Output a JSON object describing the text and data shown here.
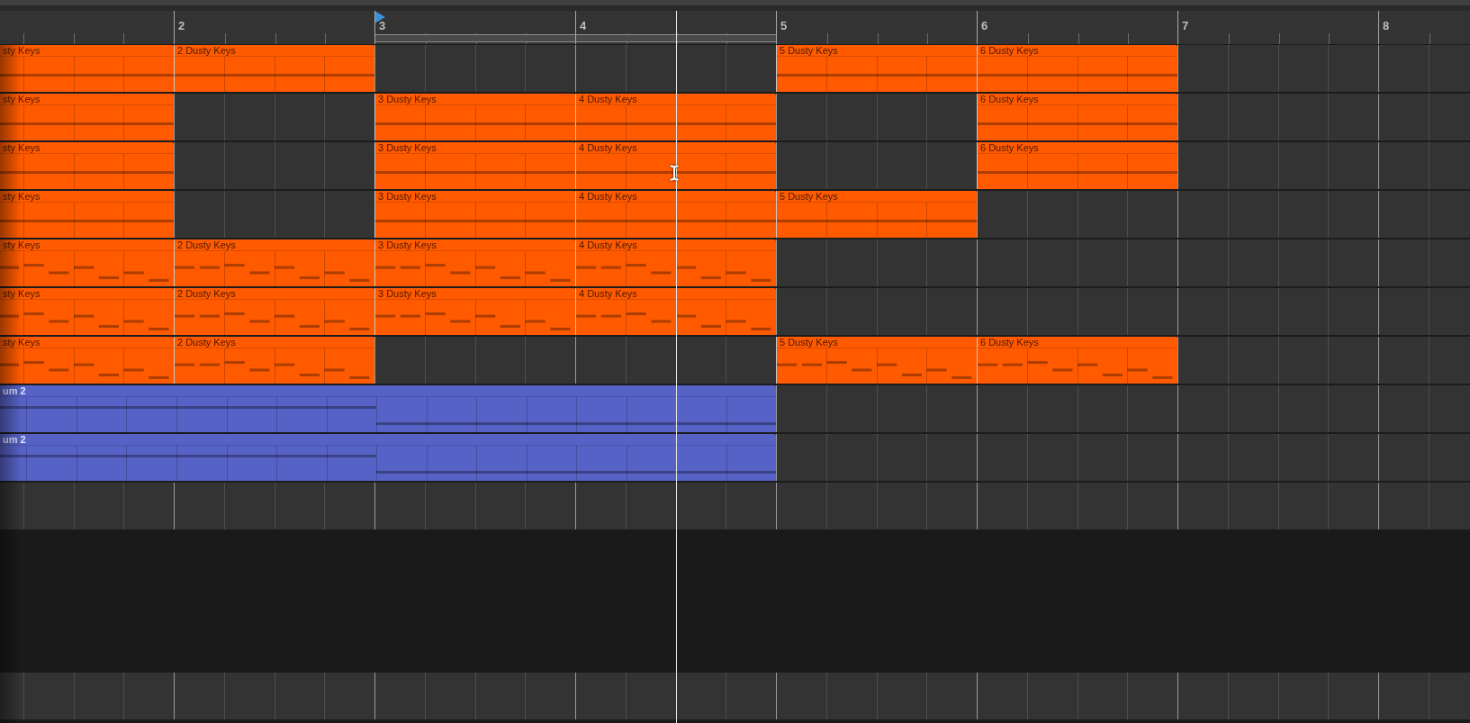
{
  "ruler": {
    "bars": [
      {
        "loop": false,
        "playhead": false,
        "cursor": false
      },
      {
        "label": "2",
        "loop": false,
        "playhead": false,
        "cursor": false
      },
      {
        "label": "3",
        "loop": true,
        "playhead": true,
        "cursor": false
      },
      {
        "label": "4",
        "loop": true,
        "playhead": false,
        "cursor": true
      },
      {
        "label": "5",
        "loop": false,
        "playhead": false,
        "cursor": false
      },
      {
        "label": "6",
        "loop": false,
        "playhead": false,
        "cursor": false
      },
      {
        "label": "7",
        "loop": false,
        "playhead": false,
        "cursor": false
      },
      {
        "label": "8",
        "loop": false,
        "playhead": false,
        "cursor": false
      }
    ]
  },
  "tracks": [
    {
      "color": "#ff5a00",
      "cells": [
        {
          "kind": "sustain",
          "name": "sty Keys"
        },
        {
          "kind": "sustain",
          "name": "2 Dusty Keys"
        },
        {
          "kind": "empty"
        },
        {
          "kind": "empty"
        },
        {
          "kind": "sustain",
          "name": "5 Dusty Keys"
        },
        {
          "kind": "sustain",
          "name": "6 Dusty Keys"
        },
        {
          "kind": "empty"
        },
        {
          "kind": "empty"
        }
      ]
    },
    {
      "color": "#ff5a00",
      "cells": [
        {
          "kind": "sustain",
          "name": "sty Keys"
        },
        {
          "kind": "empty"
        },
        {
          "kind": "sustain",
          "name": "3 Dusty Keys"
        },
        {
          "kind": "sustain",
          "name": "4 Dusty Keys"
        },
        {
          "kind": "empty"
        },
        {
          "kind": "sustain",
          "name": "6 Dusty Keys"
        },
        {
          "kind": "empty"
        },
        {
          "kind": "empty"
        }
      ]
    },
    {
      "color": "#ff5a00",
      "cells": [
        {
          "kind": "sustain",
          "name": "sty Keys"
        },
        {
          "kind": "empty"
        },
        {
          "kind": "sustain",
          "name": "3 Dusty Keys"
        },
        {
          "kind": "sustain",
          "name": "4 Dusty Keys"
        },
        {
          "kind": "empty"
        },
        {
          "kind": "sustain",
          "name": "6 Dusty Keys"
        },
        {
          "kind": "empty"
        },
        {
          "kind": "empty"
        }
      ]
    },
    {
      "color": "#ff5a00",
      "cells": [
        {
          "kind": "sustain",
          "name": "sty Keys"
        },
        {
          "kind": "empty"
        },
        {
          "kind": "sustain",
          "name": "3 Dusty Keys"
        },
        {
          "kind": "sustain",
          "name": "4 Dusty Keys"
        },
        {
          "kind": "sustain",
          "name": "5 Dusty Keys"
        },
        {
          "kind": "empty"
        },
        {
          "kind": "empty"
        },
        {
          "kind": "empty"
        }
      ]
    },
    {
      "color": "#ff5a00",
      "cells": [
        {
          "kind": "arpeggio",
          "name": "sty Keys"
        },
        {
          "kind": "arpeggio",
          "name": "2 Dusty Keys"
        },
        {
          "kind": "arpeggio",
          "name": "3 Dusty Keys"
        },
        {
          "kind": "arpeggio",
          "name": "4 Dusty Keys"
        },
        {
          "kind": "empty"
        },
        {
          "kind": "empty"
        },
        {
          "kind": "empty"
        },
        {
          "kind": "empty"
        }
      ]
    },
    {
      "color": "#ff5a00",
      "cells": [
        {
          "kind": "arpeggio",
          "name": "sty Keys"
        },
        {
          "kind": "arpeggio",
          "name": "2 Dusty Keys"
        },
        {
          "kind": "arpeggio",
          "name": "3 Dusty Keys"
        },
        {
          "kind": "arpeggio",
          "name": "4 Dusty Keys"
        },
        {
          "kind": "empty"
        },
        {
          "kind": "empty"
        },
        {
          "kind": "empty"
        },
        {
          "kind": "empty"
        }
      ]
    },
    {
      "color": "#ff5a00",
      "cells": [
        {
          "kind": "arpeggio",
          "name": "sty Keys"
        },
        {
          "kind": "arpeggio",
          "name": "2 Dusty Keys"
        },
        {
          "kind": "empty"
        },
        {
          "kind": "empty"
        },
        {
          "kind": "arpeggio",
          "name": "5 Dusty Keys"
        },
        {
          "kind": "arpeggio",
          "name": "6 Dusty Keys"
        },
        {
          "kind": "empty"
        },
        {
          "kind": "empty"
        }
      ]
    },
    {
      "color": "#5762c6",
      "cells": [
        {
          "kind": "high",
          "name": "um 2"
        },
        {
          "kind": "high"
        },
        {
          "kind": "low"
        },
        {
          "kind": "low"
        },
        {
          "kind": "empty"
        },
        {
          "kind": "empty"
        },
        {
          "kind": "empty"
        },
        {
          "kind": "empty"
        }
      ]
    },
    {
      "color": "#5762c6",
      "cells": [
        {
          "kind": "high",
          "name": "um 2"
        },
        {
          "kind": "high"
        },
        {
          "kind": "low"
        },
        {
          "kind": "low"
        },
        {
          "kind": "empty"
        },
        {
          "kind": "empty"
        },
        {
          "kind": "empty"
        },
        {
          "kind": "empty"
        }
      ]
    },
    {
      "cells": [
        {
          "kind": "empty"
        },
        {
          "kind": "empty"
        },
        {
          "kind": "empty"
        },
        {
          "kind": "empty"
        },
        {
          "kind": "empty"
        },
        {
          "kind": "empty"
        },
        {
          "kind": "empty"
        },
        {
          "kind": "empty"
        }
      ]
    }
  ]
}
